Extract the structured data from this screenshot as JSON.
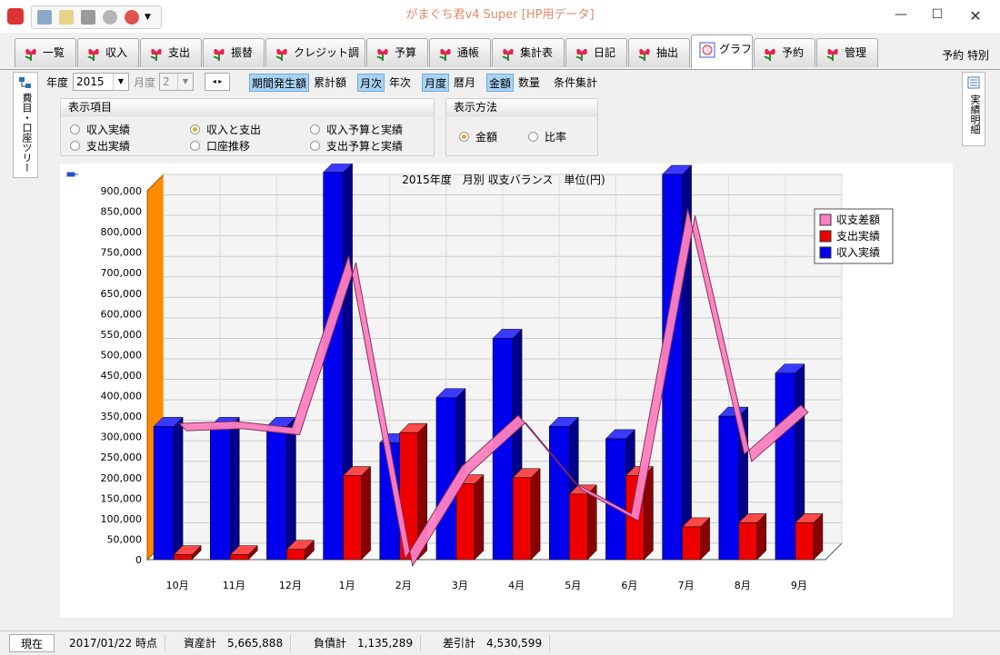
{
  "window": {
    "title": "がまぐち君v4 Super  [HP用データ]"
  },
  "tabs": [
    {
      "label": "一覧"
    },
    {
      "label": "収入"
    },
    {
      "label": "支出"
    },
    {
      "label": "振替"
    },
    {
      "label": "クレジット調整"
    },
    {
      "label": "予算"
    },
    {
      "label": "通帳"
    },
    {
      "label": "集計表"
    },
    {
      "label": "日記"
    },
    {
      "label": "抽出"
    },
    {
      "label": "グラフ"
    },
    {
      "label": "予約"
    },
    {
      "label": "管理"
    }
  ],
  "tabbar_right": "予約  特別",
  "side": {
    "left_label": "費目・口座ツリー",
    "right_label": "実績明細"
  },
  "toolbar": {
    "year_label": "年度",
    "year_value": "2015",
    "month_label": "月度",
    "month_value": "2",
    "period_occurrence": "期間発生額",
    "cumulative": "累計額",
    "monthly": "月次",
    "yearly": "年次",
    "fiscal_month": "月度",
    "calendar_month": "暦月",
    "amount": "金額",
    "quantity": "数量",
    "conditional": "条件集計"
  },
  "display_items": {
    "header": "表示項目",
    "options": [
      "収入実績",
      "収入と支出",
      "収入予算と実績",
      "支出実績",
      "口座推移",
      "支出予算と実績"
    ],
    "selected": "収入と支出"
  },
  "display_method": {
    "header": "表示方法",
    "options": [
      "金額",
      "比率"
    ],
    "selected": "金額"
  },
  "chart_data": {
    "type": "bar",
    "title": "2015年度　月別 収支バランス　単位(円)",
    "categories": [
      "10月",
      "11月",
      "12月",
      "1月",
      "2月",
      "3月",
      "4月",
      "5月",
      "6月",
      "7月",
      "8月",
      "9月"
    ],
    "series": [
      {
        "name": "収支差額",
        "type": "line",
        "color": "#ff80c0",
        "values": [
          310000,
          315000,
          300000,
          720000,
          -20000,
          205000,
          330000,
          165000,
          90000,
          835000,
          235000,
          355000
        ]
      },
      {
        "name": "支出実績",
        "type": "bar",
        "color": "#ee0000",
        "values": [
          12000,
          12000,
          25000,
          205000,
          310000,
          185000,
          200000,
          160000,
          205000,
          80000,
          90000,
          90000
        ]
      },
      {
        "name": "収入実績",
        "type": "bar",
        "color": "#0000ee",
        "values": [
          325000,
          325000,
          325000,
          945000,
          285000,
          395000,
          540000,
          325000,
          295000,
          940000,
          350000,
          455000
        ]
      }
    ],
    "ylim": [
      0,
      900000
    ],
    "yticks": [
      "0",
      "50,000",
      "100,000",
      "150,000",
      "200,000",
      "250,000",
      "300,000",
      "350,000",
      "400,000",
      "450,000",
      "500,000",
      "550,000",
      "600,000",
      "650,000",
      "700,000",
      "750,000",
      "800,000",
      "850,000",
      "900,000"
    ],
    "legend": [
      "収支差額",
      "支出実績",
      "収入実績"
    ],
    "legend_position": "top-right",
    "grid": true
  },
  "status": {
    "now_button": "現在",
    "datetime": "2017/01/22 時点",
    "assets": "資産計　5,665,888",
    "liabilities": "負債計　1,135,289",
    "net": "差引計　4,530,599"
  }
}
